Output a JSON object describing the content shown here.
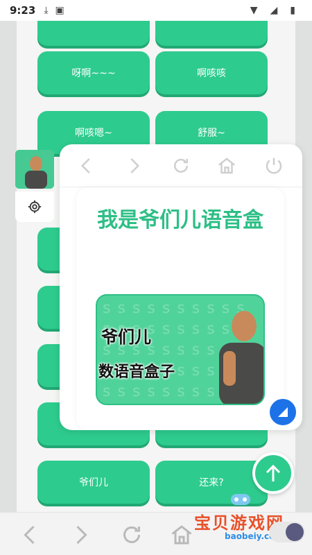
{
  "status_bar": {
    "time": "9:23"
  },
  "buttons": [
    {
      "label": ""
    },
    {
      "label": ""
    },
    {
      "label": "呀啊~~~"
    },
    {
      "label": "啊咳咳"
    },
    {
      "label": "啊咳嗯~"
    },
    {
      "label": "舒服~"
    },
    {
      "label": "爷们儿"
    },
    {
      "label": "还来?"
    }
  ],
  "float_window": {
    "title": "我是爷们儿语音盒",
    "banner_line1": "爷们儿",
    "banner_line2": "数语音盒子"
  },
  "watermark": {
    "name": "宝贝游戏网",
    "url": "baobeiy.com"
  },
  "colors": {
    "accent": "#2ecb8e",
    "title": "#2dbf86",
    "fab_blue": "#1e72e8",
    "watermark_red": "#e8502a"
  }
}
